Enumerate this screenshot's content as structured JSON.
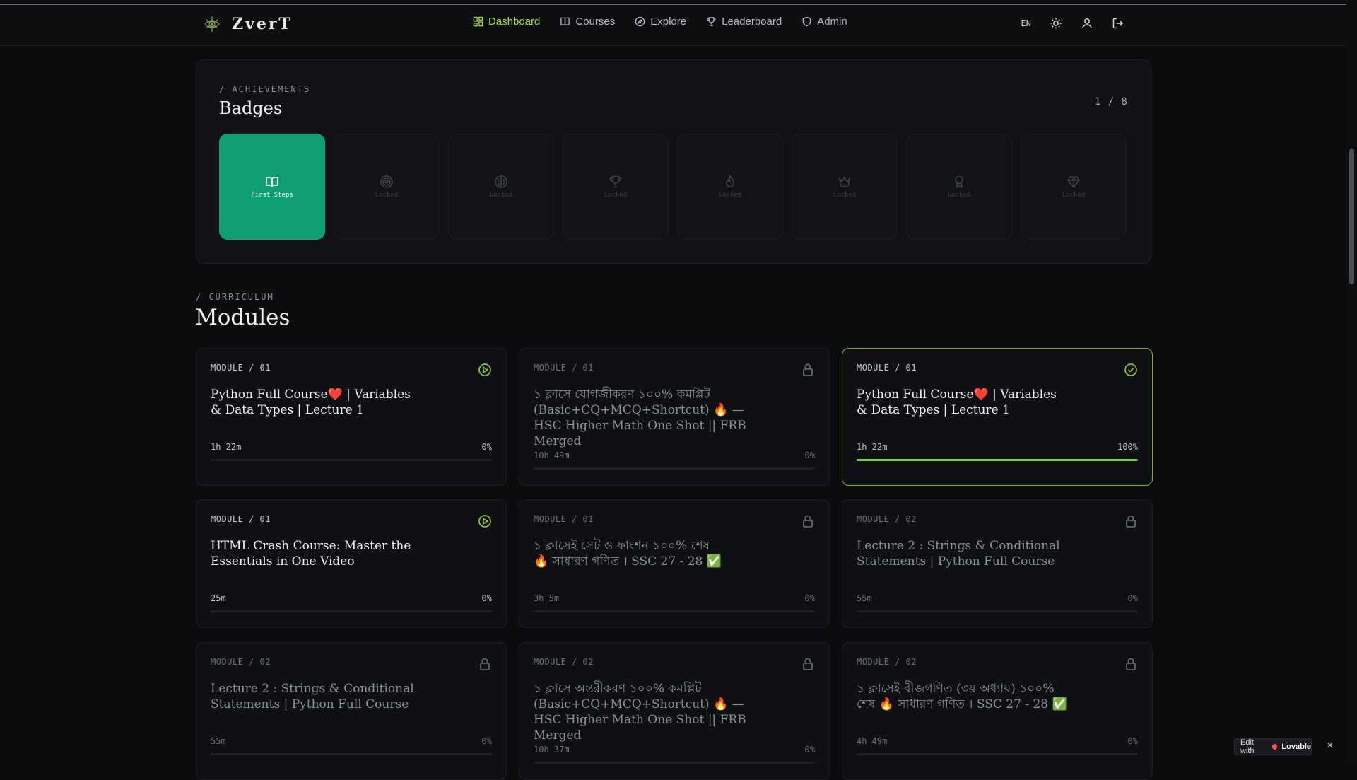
{
  "header": {
    "brand": "ZverT",
    "nav": [
      {
        "label": "Dashboard",
        "icon": "dashboard-icon",
        "active": true
      },
      {
        "label": "Courses",
        "icon": "book-icon",
        "active": false
      },
      {
        "label": "Explore",
        "icon": "compass-icon",
        "active": false
      },
      {
        "label": "Leaderboard",
        "icon": "trophy-icon",
        "active": false
      },
      {
        "label": "Admin",
        "icon": "shield-icon",
        "active": false
      }
    ],
    "language": "EN"
  },
  "achievements": {
    "eyebrow": "/ ACHIEVEMENTS",
    "title": "Badges",
    "count": "1 / 8",
    "badges": [
      {
        "label": "First Steps",
        "icon": "book-open-icon",
        "unlocked": true
      },
      {
        "label": "Locked",
        "icon": "target-icon",
        "unlocked": false
      },
      {
        "label": "Locked",
        "icon": "brain-icon",
        "unlocked": false
      },
      {
        "label": "Locked",
        "icon": "trophy-icon",
        "unlocked": false
      },
      {
        "label": "Locked",
        "icon": "flame-icon",
        "unlocked": false
      },
      {
        "label": "Locked",
        "icon": "crown-icon",
        "unlocked": false
      },
      {
        "label": "Locked",
        "icon": "award-icon",
        "unlocked": false
      },
      {
        "label": "Locked",
        "icon": "gem-icon",
        "unlocked": false
      }
    ]
  },
  "curriculum": {
    "eyebrow": "/ CURRICULUM",
    "title": "Modules",
    "modules": [
      {
        "module": "MODULE / 01",
        "title": "Python Full Course❤️ | Variables & Data Types | Lecture 1",
        "duration": "1h 22m",
        "progress": "0%",
        "status": "play",
        "progress_fraction": 0
      },
      {
        "module": "MODULE / 01",
        "title": "১ ক্লাসে যোগজীকরণ ১০০% কমপ্লিট (Basic+CQ+MCQ+Shortcut) 🔥 — HSC Higher Math One Shot || FRB Merged",
        "duration": "10h 49m",
        "progress": "0%",
        "status": "locked",
        "progress_fraction": 0
      },
      {
        "module": "MODULE / 01",
        "title": "Python Full Course❤️ | Variables & Data Types | Lecture 1",
        "duration": "1h 22m",
        "progress": "100%",
        "status": "completed",
        "progress_fraction": 1
      },
      {
        "module": "MODULE / 01",
        "title": "HTML Crash Course: Master the Essentials in One Video",
        "duration": "25m",
        "progress": "0%",
        "status": "play",
        "progress_fraction": 0
      },
      {
        "module": "MODULE / 01",
        "title": "১ ক্লাসেই সেট ও ফাংশন ১০০% শেষ 🔥 সাধারণ গণিত । SSC 27 - 28 ✅",
        "duration": "3h 5m",
        "progress": "0%",
        "status": "locked",
        "progress_fraction": 0
      },
      {
        "module": "MODULE / 02",
        "title": "Lecture 2 : Strings & Conditional Statements | Python Full Course",
        "duration": "55m",
        "progress": "0%",
        "status": "locked",
        "progress_fraction": 0
      },
      {
        "module": "MODULE / 02",
        "title": "Lecture 2 : Strings & Conditional Statements | Python Full Course",
        "duration": "55m",
        "progress": "0%",
        "status": "locked",
        "progress_fraction": 0
      },
      {
        "module": "MODULE / 02",
        "title": "১ ক্লাসে অন্তরীকরণ ১০০% কমপ্লিট (Basic+CQ+MCQ+Shortcut) 🔥 — HSC Higher Math One Shot || FRB Merged",
        "duration": "10h 37m",
        "progress": "0%",
        "status": "locked",
        "progress_fraction": 0
      },
      {
        "module": "MODULE / 02",
        "title": "১ ক্লাসেই বীজগণিত (৩য় অধ্যায়) ১০০% শেষ 🔥 সাধারণ গণিত । SSC 27 - 28 ✅",
        "duration": "4h 49m",
        "progress": "0%",
        "status": "locked",
        "progress_fraction": 0
      }
    ]
  },
  "lovable_badge": {
    "prefix": "Edit with",
    "brand": "Lovable",
    "close": "✕"
  },
  "colors": {
    "accent": "#a6e22e",
    "badge_unlocked": "#0f9d74",
    "progress_fill": "#6ed43a"
  }
}
